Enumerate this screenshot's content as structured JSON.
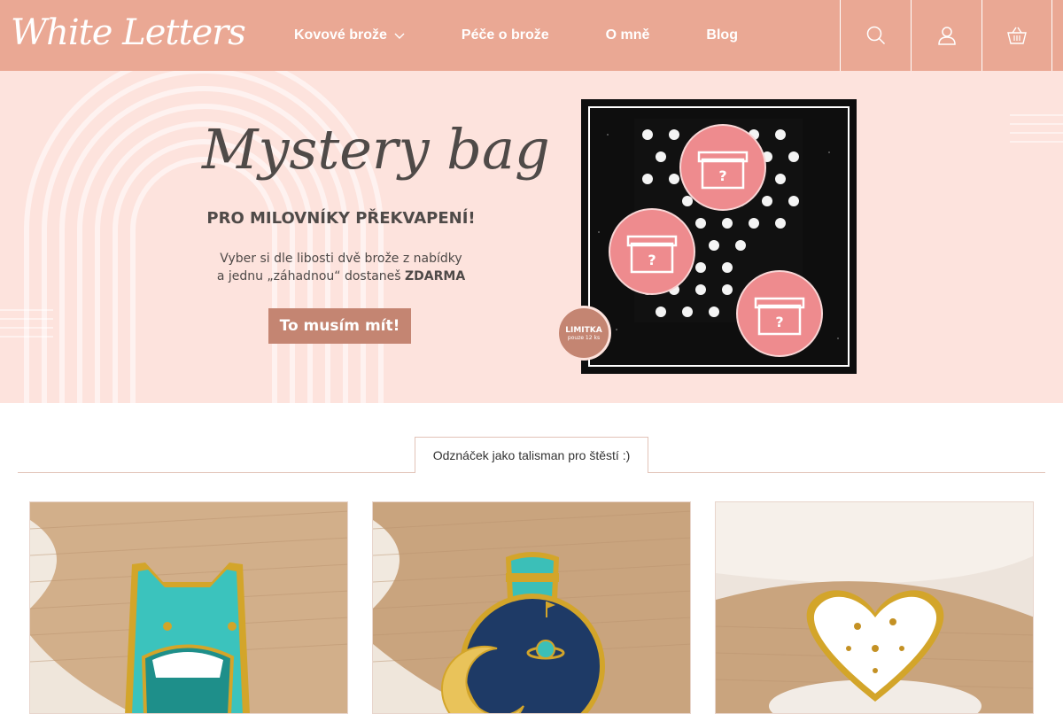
{
  "header": {
    "logo_text": "White Letters",
    "nav": [
      {
        "label": "Kovové brože",
        "has_dropdown": true
      },
      {
        "label": "Péče o brože"
      },
      {
        "label": "O mně"
      },
      {
        "label": "Blog"
      }
    ],
    "icons": [
      "search-icon",
      "user-icon",
      "basket-icon"
    ]
  },
  "banner": {
    "title": "Mystery bag",
    "subtitle": "PRO MILOVNÍKY PŘEKVAPENÍ!",
    "desc_line1": "Vyber si dle libosti dvě brože z nabídky",
    "desc_line2_prefix": "a jednu „záhadnou“ dostaneš ",
    "desc_line2_bold": "ZDARMA",
    "button_label": "To musím mít!",
    "badge_line1": "LIMITKA",
    "badge_line2": "pouze 12 ks"
  },
  "section": {
    "tab_label": "Odznáček jako talisman pro štěstí :)"
  },
  "products": [
    {
      "name": "monster-pin",
      "color": "#3bbfb8"
    },
    {
      "name": "space-bottle-pin",
      "color": "#1e3a66"
    },
    {
      "name": "heart-pin",
      "color": "#ffffff"
    }
  ],
  "colors": {
    "header_bg": "#eaa894",
    "banner_bg": "#fde3dd",
    "button_bg": "#c48572",
    "text_dark": "#4f4a48"
  }
}
